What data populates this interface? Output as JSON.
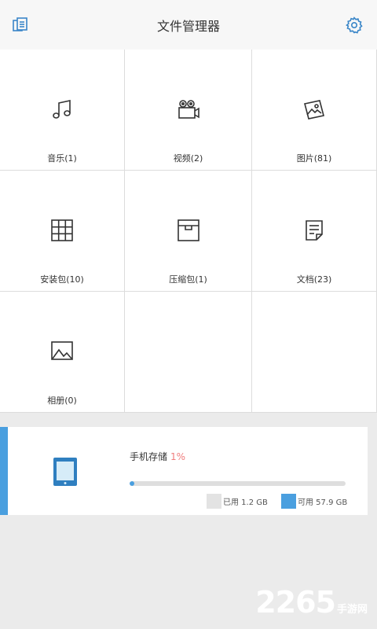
{
  "header": {
    "title": "文件管理器",
    "left_icon": "file-manager-icon",
    "right_icon": "gear-icon",
    "accent": "#4a9fdf"
  },
  "categories": [
    {
      "label": "音乐(1)",
      "icon": "music-note-icon"
    },
    {
      "label": "视频(2)",
      "icon": "video-camera-icon"
    },
    {
      "label": "图片(81)",
      "icon": "pictures-icon"
    },
    {
      "label": "安装包(10)",
      "icon": "grid-package-icon"
    },
    {
      "label": "压缩包(1)",
      "icon": "archive-box-icon"
    },
    {
      "label": "文档(23)",
      "icon": "document-icon"
    },
    {
      "label": "相册(0)",
      "icon": "album-icon"
    }
  ],
  "storage": {
    "title": "手机存储",
    "percent": "1%",
    "used_fraction": 0.02,
    "used_label": "已用 1.2 GB",
    "available_label": "可用 57.9 GB",
    "used_color": "#e3e3e3",
    "available_color": "#4a9fdf",
    "icon": "phone-device-icon"
  },
  "watermark": {
    "number": "2265",
    "site": "手游网"
  }
}
